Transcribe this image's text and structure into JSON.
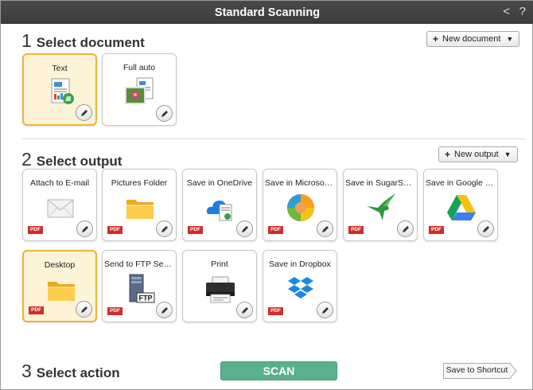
{
  "window": {
    "title": "Standard Scanning",
    "back_glyph": "<",
    "help_glyph": "?"
  },
  "section1": {
    "number": "1",
    "label": "Select document",
    "new_button": "New document"
  },
  "documents": [
    {
      "label": "Text",
      "selected": true,
      "icon": "text-document-icon"
    },
    {
      "label": "Full auto",
      "selected": false,
      "icon": "full-auto-photo-icon"
    }
  ],
  "section2": {
    "number": "2",
    "label": "Select output",
    "new_button": "New output"
  },
  "outputs": [
    {
      "label": "Attach to E-mail",
      "badge": "PDF",
      "icon": "envelope-icon"
    },
    {
      "label": "Pictures Folder",
      "badge": "PDF",
      "icon": "folder-icon"
    },
    {
      "label": "Save in OneDrive",
      "badge": "PDF",
      "icon": "onedrive-icon"
    },
    {
      "label": "Save in Microsoft S...",
      "badge": "PDF",
      "icon": "microsoft-sharepoint-icon"
    },
    {
      "label": "Save in SugarSync",
      "badge": "PDF",
      "icon": "sugarsync-hummingbird-icon"
    },
    {
      "label": "Save in Google Dri...",
      "badge": "PDF",
      "icon": "google-drive-icon"
    },
    {
      "label": "Desktop",
      "badge": "PDF",
      "icon": "folder-icon",
      "selected": true
    },
    {
      "label": "Send to FTP Server",
      "badge": "PDF",
      "icon": "ftp-server-icon",
      "icon_text": "FTP"
    },
    {
      "label": "Print",
      "badge": "",
      "icon": "printer-icon"
    },
    {
      "label": "Save in Dropbox",
      "badge": "PDF",
      "icon": "dropbox-icon"
    }
  ],
  "section3": {
    "number": "3",
    "label": "Select action"
  },
  "actions": {
    "scan": "SCAN",
    "shortcut": "Save to Shortcut"
  },
  "colors": {
    "titlebar": "#3f3f3f",
    "selected_bg": "#fdf3d6",
    "selected_border": "#f0b33c",
    "scan": "#5aaf8d",
    "pdf_badge": "#d42a2a"
  }
}
